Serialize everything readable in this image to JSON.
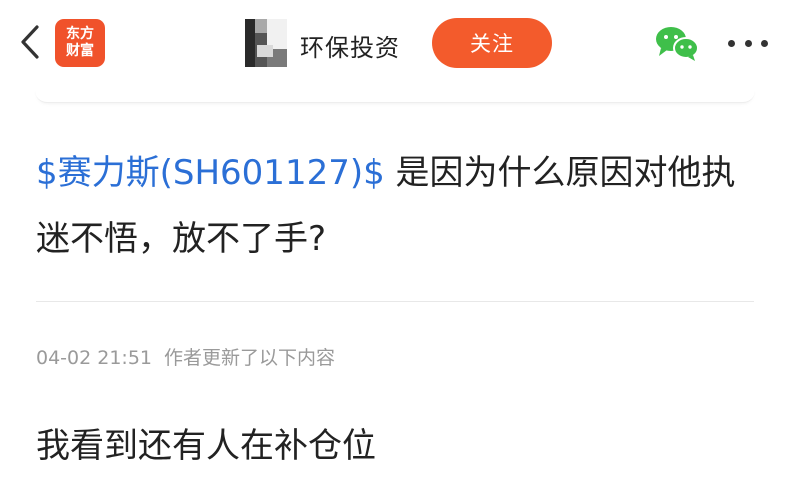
{
  "header": {
    "logo_line1": "东方",
    "logo_line2": "财富",
    "user_name": "环保投资",
    "follow_label": "关注"
  },
  "icons": {
    "back": "chevron-left-icon",
    "wechat": "wechat-icon",
    "more": "more-horizontal-icon"
  },
  "post": {
    "stock_tag": "$赛力斯(SH601127)$",
    "body": " 是因为什么原因对他执迷不悟，放不了手?"
  },
  "update": {
    "time": "04-02 21:51",
    "label": "作者更新了以下内容",
    "content": "我看到还有人在补仓位"
  },
  "colors": {
    "brand": "#f0522b",
    "follow_button": "#f35b2c",
    "link": "#2b6fd6",
    "wechat": "#3fbf4a"
  }
}
